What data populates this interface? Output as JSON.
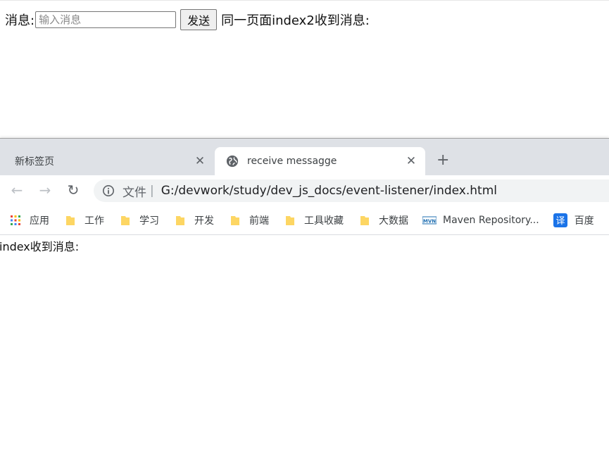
{
  "top_page": {
    "message_label": "消息:",
    "input_placeholder": "输入消息",
    "input_value": "",
    "send_label": "发送",
    "received_text": "同一页面index2收到消息:"
  },
  "browser": {
    "tabs": [
      {
        "title": "新标签页",
        "active": false
      },
      {
        "title": "receive messagge",
        "active": true
      }
    ],
    "omnibox": {
      "scheme_label": "文件",
      "separator": "|",
      "url": "G:/devwork/study/dev_js_docs/event-listener/index.html"
    },
    "bookmarks": [
      {
        "label": "应用",
        "icon": "apps-grid-icon"
      },
      {
        "label": "工作",
        "icon": "folder-icon"
      },
      {
        "label": "学习",
        "icon": "folder-icon"
      },
      {
        "label": "开发",
        "icon": "folder-icon"
      },
      {
        "label": "前端",
        "icon": "folder-icon"
      },
      {
        "label": "工具收藏",
        "icon": "folder-icon"
      },
      {
        "label": "大数据",
        "icon": "folder-icon"
      },
      {
        "label": "Maven Repository...",
        "icon": "maven-icon",
        "icon_text": "MVN"
      },
      {
        "label": "百度",
        "icon": "translate-icon",
        "icon_text": "译"
      }
    ],
    "page": {
      "received_text": "index收到消息:"
    }
  },
  "colors": {
    "tabstrip_bg": "#dee1e6",
    "omnibox_bg": "#f1f3f4",
    "folder_yellow": "#fdd663",
    "translate_blue": "#1a73e8"
  }
}
